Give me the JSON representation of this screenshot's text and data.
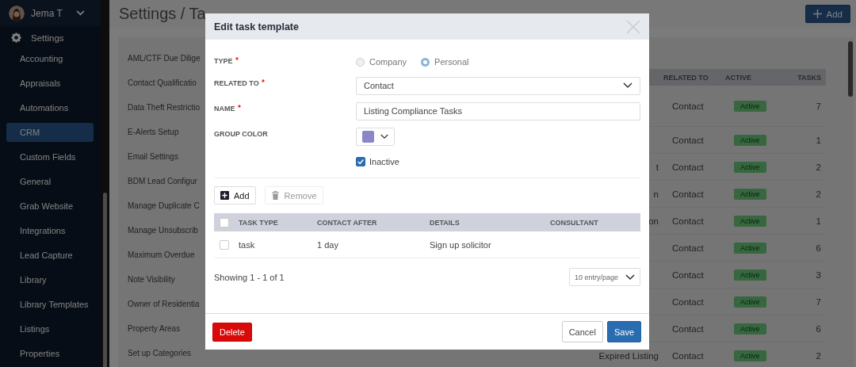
{
  "user": {
    "name": "Jema T"
  },
  "sidebar": {
    "section": "Settings",
    "items": [
      {
        "label": "Accounting",
        "selected": false
      },
      {
        "label": "Appraisals",
        "selected": false
      },
      {
        "label": "Automations",
        "selected": false
      },
      {
        "label": "CRM",
        "selected": true
      },
      {
        "label": "Custom Fields",
        "selected": false
      },
      {
        "label": "General",
        "selected": false
      },
      {
        "label": "Grab Website",
        "selected": false
      },
      {
        "label": "Integrations",
        "selected": false
      },
      {
        "label": "Lead Capture",
        "selected": false
      },
      {
        "label": "Library",
        "selected": false
      },
      {
        "label": "Library Templates",
        "selected": false
      },
      {
        "label": "Listings",
        "selected": false
      },
      {
        "label": "Properties",
        "selected": false
      }
    ]
  },
  "page": {
    "title": "Settings / Ta",
    "add_button": "Add"
  },
  "settings_list": [
    "AML/CTF Due Dilige",
    "Contact Qualificatio",
    "Data Theft Restrictio",
    "E-Alerts Setup",
    "Email Settings",
    "BDM Lead Configur",
    "Manage Duplicate C",
    "Manage Unsubscrib",
    "Maximum Overdue",
    "Note Visibility",
    "Owner of Residentia",
    "Property Areas",
    "Set up Categories"
  ],
  "templates_table": {
    "columns": [
      "RELATED TO",
      "ACTIVE",
      "TASKS"
    ],
    "rows": [
      {
        "related_to": "Contact",
        "status": "Active",
        "tasks": "7"
      },
      {
        "related_to": "Contact",
        "status": "Active",
        "tasks": "1"
      },
      {
        "name": "t",
        "related_to": "Contact",
        "status": "Active",
        "tasks": "2"
      },
      {
        "name": "n",
        "related_to": "Contact",
        "status": "Active",
        "tasks": "2"
      },
      {
        "name": "on",
        "related_to": "Contact",
        "status": "Active",
        "tasks": "1"
      },
      {
        "related_to": "Contact",
        "status": "Active",
        "tasks": "6"
      },
      {
        "related_to": "Contact",
        "status": "Active",
        "tasks": "3"
      },
      {
        "related_to": "Contact",
        "status": "Active",
        "tasks": "7"
      },
      {
        "related_to": "Contact",
        "status": "Active",
        "tasks": "6"
      },
      {
        "name": "Expired Listing",
        "related_to": "Contact",
        "status": "Active",
        "tasks": "2"
      }
    ]
  },
  "dialog": {
    "title": "Edit task template",
    "fields": [
      {
        "label": "TYPE",
        "required": true,
        "kind": "radio",
        "options": [
          {
            "label": "Company",
            "selected": false
          },
          {
            "label": "Personal",
            "selected": true
          }
        ]
      },
      {
        "label": "RELATED TO",
        "required": true,
        "kind": "select",
        "value": "Contact"
      },
      {
        "label": "NAME",
        "required": true,
        "kind": "text",
        "value": "Listing Compliance Tasks"
      },
      {
        "label": "GROUP COLOR",
        "required": false,
        "kind": "color",
        "color": "#8b86c9"
      }
    ],
    "inactive": {
      "label": "Inactive",
      "checked": true
    },
    "toolbar": [
      {
        "label": "Add",
        "kind": "add",
        "disabled": false
      },
      {
        "label": "Remove",
        "kind": "remove",
        "disabled": true
      }
    ],
    "tasks_table": {
      "header_checked": false,
      "columns": [
        "TASK TYPE",
        "CONTACT AFTER",
        "DETAILS",
        "CONSULTANT"
      ],
      "rows": [
        {
          "checked": false,
          "cells": [
            "task",
            "1 day",
            "Sign up solicitor"
          ]
        }
      ]
    },
    "pagination": {
      "summary": "Showing 1 - 1 of 1",
      "page_size": "10 entry/page"
    },
    "buttons": {
      "delete": "Delete",
      "cancel": "Cancel",
      "save": "Save"
    }
  }
}
